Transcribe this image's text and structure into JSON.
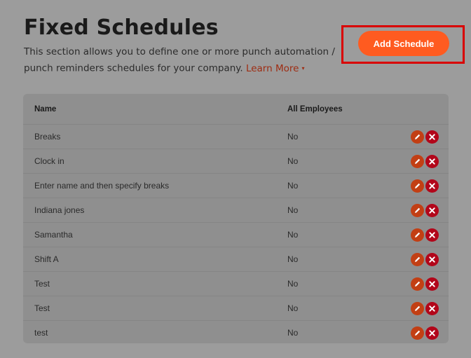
{
  "header": {
    "title": "Fixed Schedules",
    "description": "This section allows you to define one or more punch automation / punch reminders schedules for your company.",
    "learn_more_label": "Learn More",
    "learn_more_caret": "▾"
  },
  "toolbar": {
    "add_schedule_label": "Add Schedule"
  },
  "table": {
    "columns": {
      "name": "Name",
      "all_employees": "All Employees"
    },
    "rows": [
      {
        "name": "Breaks",
        "all_employees": "No"
      },
      {
        "name": "Clock in",
        "all_employees": "No"
      },
      {
        "name": "Enter name and then specify breaks",
        "all_employees": "No"
      },
      {
        "name": "Indiana jones",
        "all_employees": "No"
      },
      {
        "name": "Samantha",
        "all_employees": "No"
      },
      {
        "name": "Shift A",
        "all_employees": "No"
      },
      {
        "name": "Test",
        "all_employees": "No"
      },
      {
        "name": "Test",
        "all_employees": "No"
      },
      {
        "name": "test",
        "all_employees": "No"
      }
    ],
    "row_actions": {
      "edit_icon": "pencil-icon",
      "delete_icon": "close-icon"
    }
  },
  "colors": {
    "accent": "#ff5b20",
    "link": "#9e2c12",
    "edit": "#c23f14",
    "delete": "#b2061a",
    "highlight": "#d90000"
  }
}
